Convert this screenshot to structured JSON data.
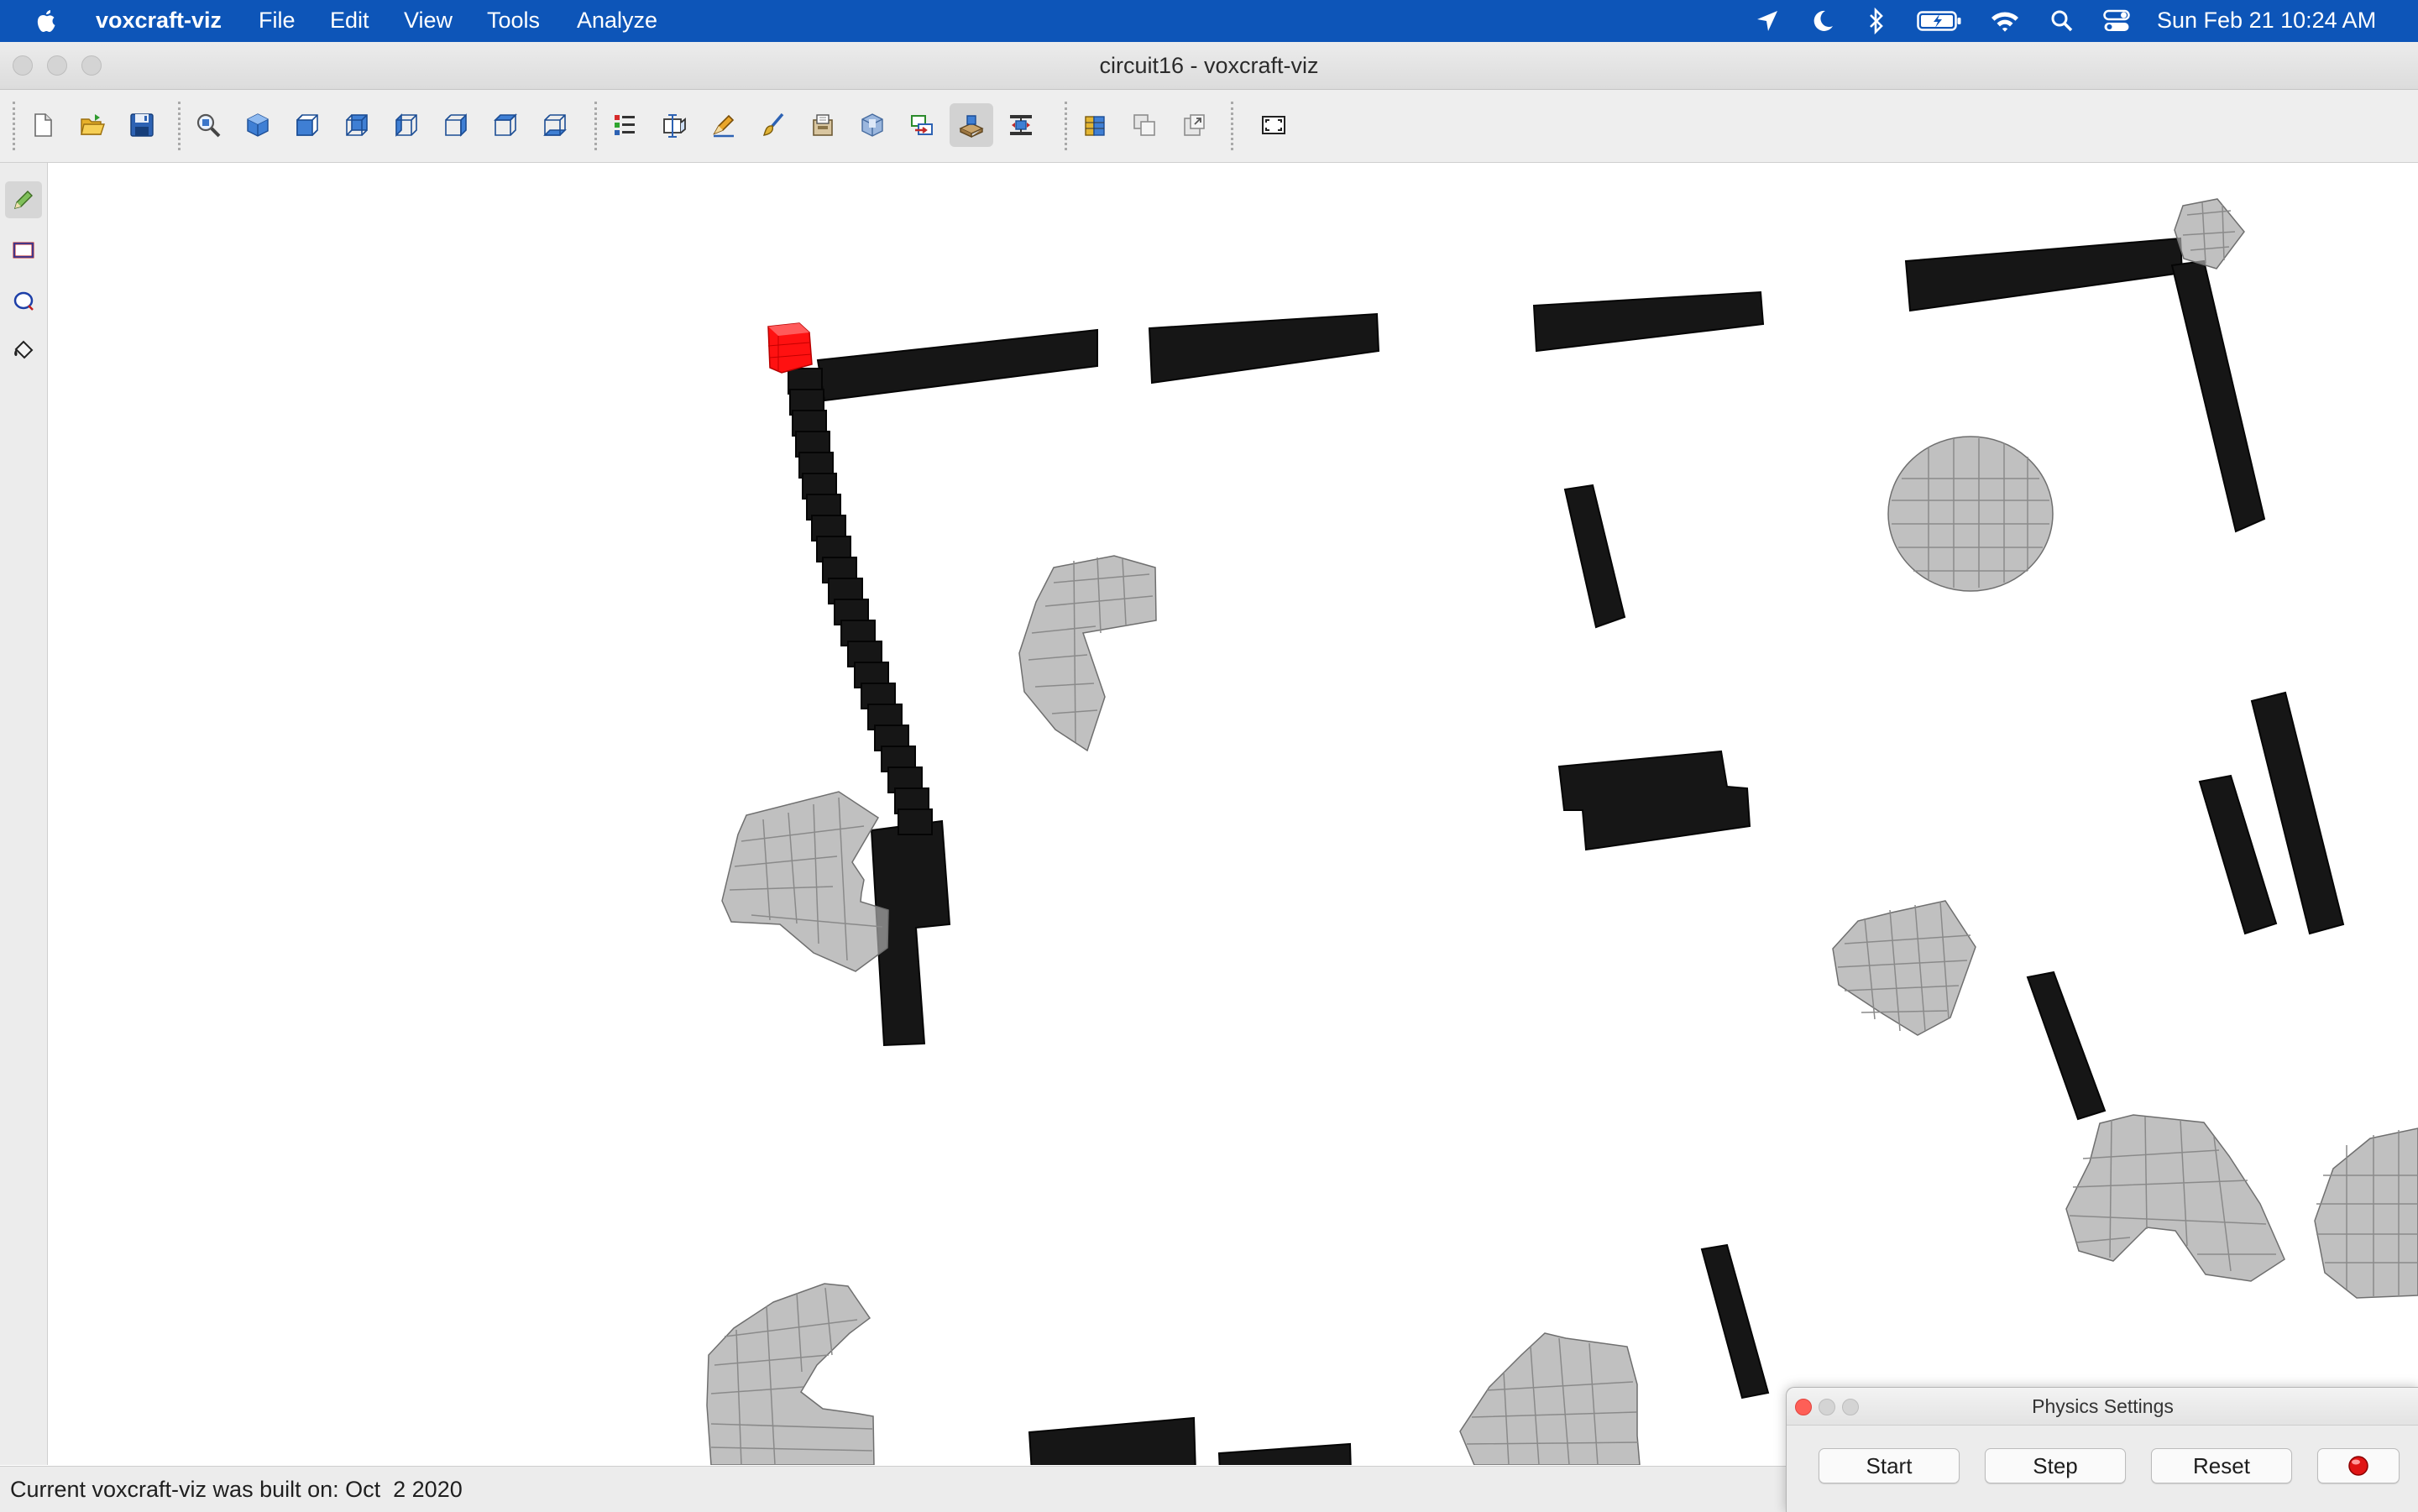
{
  "menubar": {
    "apple_icon": "apple-icon",
    "app_name": "voxcraft-viz",
    "items": [
      "File",
      "Edit",
      "View",
      "Tools",
      "Analyze"
    ],
    "status_icons": [
      "location-icon",
      "moon-icon",
      "bluetooth-icon",
      "battery-icon",
      "wifi-icon",
      "search-icon",
      "control-center-icon"
    ],
    "clock": "Sun Feb 21  10:24 AM",
    "background_color": "#0d55b8"
  },
  "window": {
    "title": "circuit16 - voxcraft-viz"
  },
  "toolbar": {
    "groups": [
      [
        "new-file-icon",
        "open-file-icon",
        "save-icon"
      ],
      [
        "zoom-fit-icon",
        "view-iso-icon",
        "view-front-icon",
        "view-back-icon",
        "view-left-icon",
        "view-right-icon",
        "view-top-icon",
        "view-bottom-icon"
      ],
      [
        "palette-list-icon",
        "structure-icon",
        "edit-material-icon",
        "brush-icon",
        "import-icon",
        "export-icon",
        "link-icon",
        "physics-sandbox-icon",
        "tensile-test-icon"
      ],
      [
        "fea-icon",
        "copy-icon",
        "paste-icon"
      ],
      [
        "fullscreen-icon"
      ]
    ],
    "active": "physics-sandbox-icon"
  },
  "left_tools": {
    "items": [
      "pencil-tool-icon",
      "rectangle-tool-icon",
      "ellipse-tool-icon",
      "fill-bucket-tool-icon"
    ],
    "active": "pencil-tool-icon"
  },
  "scene": {
    "colors": {
      "wall": "#161616",
      "robot": "#a7a7a7",
      "marker": "#ff1111"
    }
  },
  "status": {
    "text": "Current voxcraft-viz was built on: Oct  2 2020"
  },
  "physics_settings": {
    "title": "Physics Settings",
    "start_label": "Start",
    "step_label": "Step",
    "reset_label": "Reset",
    "record_icon": "record-icon"
  }
}
